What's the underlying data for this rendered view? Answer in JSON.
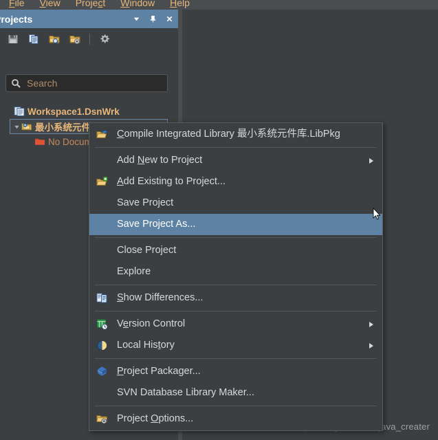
{
  "menubar": {
    "items": [
      {
        "label": "File",
        "accel": "F",
        "name": "menubar-item-file"
      },
      {
        "label": "View",
        "accel": "V",
        "name": "menubar-item-view"
      },
      {
        "label": "Project",
        "accel": "c",
        "name": "menubar-item-project"
      },
      {
        "label": "Window",
        "accel": "W",
        "name": "menubar-item-window"
      },
      {
        "label": "Help",
        "accel": "H",
        "name": "menubar-item-help"
      }
    ]
  },
  "panel": {
    "title": "Projects",
    "title_bg": "#5e82a3",
    "buttons": [
      {
        "name": "panel-dropdown-icon",
        "icon": "chevron-down-icon"
      },
      {
        "name": "panel-pin-icon",
        "icon": "pin-icon"
      },
      {
        "name": "panel-close-icon",
        "icon": "close-icon"
      }
    ],
    "toolbar": [
      {
        "name": "save-button",
        "icon": "floppy-disk-icon"
      },
      {
        "name": "save-all-button",
        "icon": "documents-icon"
      },
      {
        "name": "open-project-button",
        "icon": "folder-search-icon"
      },
      {
        "name": "project-options-button",
        "icon": "folder-gear-icon"
      },
      {
        "name": "separator",
        "icon": "divider"
      },
      {
        "name": "settings-button",
        "icon": "gear-icon"
      }
    ]
  },
  "search": {
    "placeholder": "Search",
    "value": "",
    "icon": "search-icon"
  },
  "tree": {
    "items": [
      {
        "label": "Workspace1.DsnWrk",
        "level": 0,
        "icon": "workspace-icon",
        "arrow": "",
        "selected": false,
        "bold": true
      },
      {
        "label": "最小系统元件库.LibPkg",
        "level": 1,
        "icon": "project-package-icon",
        "arrow": "expanded",
        "selected": true,
        "bold": true
      },
      {
        "label": "No Documents",
        "level": 2,
        "icon": "folder-red-icon",
        "arrow": "",
        "selected": false,
        "bold": false
      }
    ]
  },
  "context_menu": {
    "highlight_color": "#5e82a3",
    "items": [
      {
        "type": "item",
        "label": "Compile Integrated Library 最小系统元件库.LibPkg",
        "accel": "C",
        "icon": "compile-library-icon",
        "submenu": false,
        "highlighted": false,
        "name": "menu-item-compile-integrated-library"
      },
      {
        "type": "separator"
      },
      {
        "type": "item",
        "label": "Add New to Project",
        "accel": "N",
        "icon": "",
        "submenu": true,
        "highlighted": false,
        "name": "menu-item-add-new-to-project"
      },
      {
        "type": "item",
        "label": "Add Existing to Project...",
        "accel": "A",
        "icon": "add-existing-icon",
        "submenu": false,
        "highlighted": false,
        "name": "menu-item-add-existing-to-project"
      },
      {
        "type": "item",
        "label": "Save Project",
        "accel": "",
        "icon": "",
        "submenu": false,
        "highlighted": false,
        "name": "menu-item-save-project"
      },
      {
        "type": "item",
        "label": "Save Project As...",
        "accel": "",
        "icon": "",
        "submenu": false,
        "highlighted": true,
        "name": "menu-item-save-project-as"
      },
      {
        "type": "separator"
      },
      {
        "type": "item",
        "label": "Close Project",
        "accel": "",
        "icon": "",
        "submenu": false,
        "highlighted": false,
        "name": "menu-item-close-project"
      },
      {
        "type": "item",
        "label": "Explore",
        "accel": "",
        "icon": "",
        "submenu": false,
        "highlighted": false,
        "name": "menu-item-explore"
      },
      {
        "type": "separator"
      },
      {
        "type": "item",
        "label": "Show Differences...",
        "accel": "S",
        "icon": "show-differences-icon",
        "submenu": false,
        "highlighted": false,
        "name": "menu-item-show-differences"
      },
      {
        "type": "separator"
      },
      {
        "type": "item",
        "label": "Version Control",
        "accel": "e",
        "icon": "version-control-icon",
        "submenu": true,
        "highlighted": false,
        "name": "menu-item-version-control"
      },
      {
        "type": "item",
        "label": "Local History",
        "accel": "t",
        "icon": "clock-icon",
        "submenu": true,
        "highlighted": false,
        "name": "menu-item-local-history"
      },
      {
        "type": "separator"
      },
      {
        "type": "item",
        "label": "Project Packager...",
        "accel": "P",
        "icon": "package-icon",
        "submenu": false,
        "highlighted": false,
        "name": "menu-item-project-packager"
      },
      {
        "type": "item",
        "label": "SVN Database Library Maker...",
        "accel": "",
        "icon": "",
        "submenu": false,
        "highlighted": false,
        "name": "menu-item-svn-database-library-maker"
      },
      {
        "type": "separator"
      },
      {
        "type": "item",
        "label": "Project Options...",
        "accel": "O",
        "icon": "folder-gear-icon",
        "submenu": false,
        "highlighted": false,
        "name": "menu-item-project-options"
      }
    ]
  },
  "watermark": {
    "text": "https://blog.csdn.net/java_creater"
  }
}
